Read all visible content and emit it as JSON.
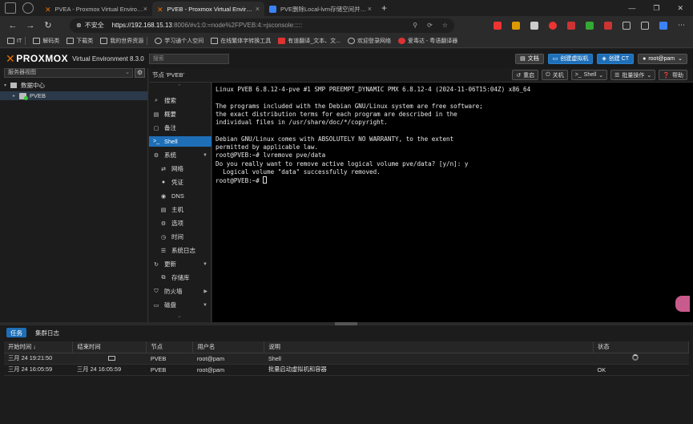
{
  "browser": {
    "tabs": [
      {
        "title": "PVEA - Proxmox Virtual Environm",
        "active": false
      },
      {
        "title": "PVEB - Proxmox Virtual Environm",
        "active": true
      },
      {
        "title": "PVE删除Local-lvm存储空间并合并",
        "active": false
      }
    ],
    "url_warning": "不安全",
    "url_host": "https://192.168.15.13",
    "url_rest": ":8006/#v1:0:=node%2FPVEB:4:=jsconsole:::::",
    "bookmarks": [
      "IT",
      "解码类",
      "下载类",
      "我的世界资源",
      "学习通个人空间",
      "在线繁体字转换工具",
      "有道翻译_文本、文...",
      "欢迎登录网络",
      "爱毒达 - 粤语翻译器"
    ]
  },
  "pve": {
    "brand": "PROXMOX",
    "version": "Virtual Environment 8.3.0",
    "search_placeholder": "搜索",
    "header_buttons": {
      "docs": "文档",
      "create_vm": "创建虚拟机",
      "create_ct": "创建 CT",
      "user": "root@pam"
    },
    "view_selector": "服务器视图",
    "tree": {
      "datacenter": "数据中心",
      "node": "PVEB"
    },
    "breadcrumb": "节点 'PVEB'",
    "toolbar": {
      "reboot": "重启",
      "shutdown": "关机",
      "shell": "Shell",
      "bulk": "批量操作",
      "help": "帮助"
    },
    "menu": [
      {
        "label": "搜索",
        "icon": "search-icon",
        "sub": false
      },
      {
        "label": "概要",
        "icon": "book-icon",
        "sub": false
      },
      {
        "label": "备注",
        "icon": "note-icon",
        "sub": false
      },
      {
        "label": "Shell",
        "icon": "terminal-icon",
        "sub": false,
        "active": true
      },
      {
        "label": "系统",
        "icon": "gears-icon",
        "sub": false,
        "expand": "down"
      },
      {
        "label": "网络",
        "icon": "network-icon",
        "sub": true
      },
      {
        "label": "凭证",
        "icon": "certificate-icon",
        "sub": true
      },
      {
        "label": "DNS",
        "icon": "globe-icon",
        "sub": true
      },
      {
        "label": "主机",
        "icon": "host-icon",
        "sub": true
      },
      {
        "label": "选项",
        "icon": "gear-icon",
        "sub": true
      },
      {
        "label": "时间",
        "icon": "clock-icon",
        "sub": true
      },
      {
        "label": "系统日志",
        "icon": "list-icon",
        "sub": true
      },
      {
        "label": "更新",
        "icon": "refresh-icon",
        "sub": false,
        "expand": "down"
      },
      {
        "label": "存储库",
        "icon": "repo-icon",
        "sub": true
      },
      {
        "label": "防火墙",
        "icon": "shield-icon",
        "sub": false,
        "expand": "right"
      },
      {
        "label": "磁盘",
        "icon": "disk-icon",
        "sub": false,
        "expand": "down"
      }
    ],
    "terminal_lines": [
      "Linux PVEB 6.8.12-4-pve #1 SMP PREEMPT_DYNAMIC PMX 6.8.12-4 (2024-11-06T15:04Z) x86_64",
      "",
      "The programs included with the Debian GNU/Linux system are free software;",
      "the exact distribution terms for each program are described in the",
      "individual files in /usr/share/doc/*/copyright.",
      "",
      "Debian GNU/Linux comes with ABSOLUTELY NO WARRANTY, to the extent",
      "permitted by applicable law.",
      "root@PVEB:~# lvremove pve/data",
      "Do you really want to remove active logical volume pve/data? [y/n]: y",
      "  Logical volume \"data\" successfully removed.",
      "root@PVEB:~# "
    ],
    "log_tabs": [
      "任务",
      "集群日志"
    ],
    "log_columns": [
      "开始时间 ↓",
      "结束时间",
      "节点",
      "用户名",
      "说明",
      "状态"
    ],
    "log_rows": [
      {
        "start": "三月 24 19:21:50",
        "end": "",
        "node": "PVEB",
        "user": "root@pam",
        "desc": "Shell",
        "status": ""
      },
      {
        "start": "三月 24 16:05:59",
        "end": "三月 24 16:05:59",
        "node": "PVEB",
        "user": "root@pam",
        "desc": "批量启动虚拟机和容器",
        "status": "OK"
      }
    ]
  }
}
